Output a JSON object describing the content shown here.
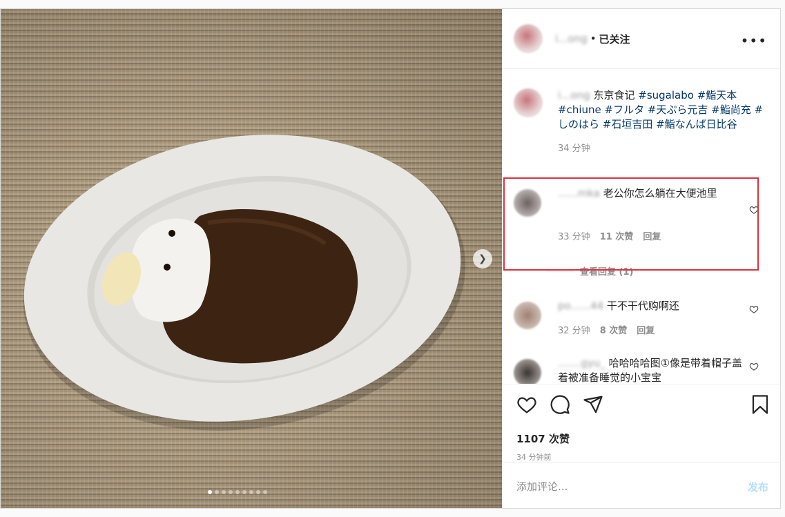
{
  "header": {
    "username": "i...ong",
    "separator": "•",
    "follow_status": "已关注",
    "more": "•••"
  },
  "caption": {
    "username": "i...ong",
    "text_plain": "东京食记",
    "tags": "#sugalabo #鮨天本 #chiune #フルタ #天ぷら元吉 #鮨尚充 #しのはら #石垣吉田 #鮨なんば日比谷",
    "time": "34 分钟"
  },
  "comments": [
    {
      "username": "......mka",
      "text": "老公你怎么躺在大便池里",
      "time": "33 分钟",
      "likes": "11 次赞",
      "reply": "回复",
      "view_replies": "查看回复 (1)"
    },
    {
      "username": "po......44",
      "text": "干不干代购啊还",
      "time": "32 分钟",
      "likes": "8 次赞",
      "reply": "回复"
    },
    {
      "username": ".......gyu_",
      "text": "哈哈哈哈图①像是带着帽子盖着被准备睡觉的小宝宝"
    }
  ],
  "actions": {
    "likes_count": "1107 次赞",
    "timestamp": "34 分钟前"
  },
  "add_comment": {
    "placeholder": "添加评论...",
    "post_label": "发布"
  },
  "colors": {
    "highlight_box": "#e0303a",
    "hashtag": "#00376b",
    "post_disabled": "#b2dffc"
  }
}
